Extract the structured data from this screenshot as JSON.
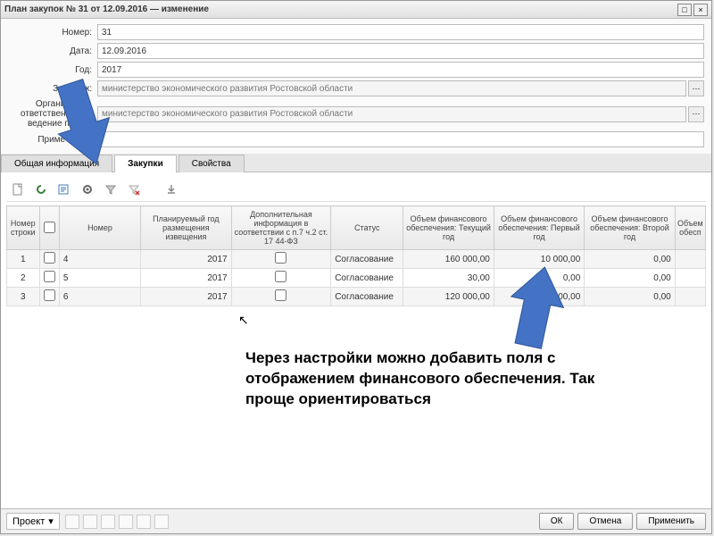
{
  "window": {
    "title": "План закупок № 31 от 12.09.2016 — изменение"
  },
  "form": {
    "number_label": "Номер:",
    "number": "31",
    "date_label": "Дата:",
    "date": "12.09.2016",
    "year_label": "Год:",
    "year": "2017",
    "customer_label": "Заказчик:",
    "customer": "министерство экономического развития Ростовской области",
    "org_label": "Организация, ответственная за ведение плана:",
    "org": "министерство экономического развития Ростовской области",
    "note_label": "Примечание:",
    "note": ""
  },
  "tabs": {
    "t0": "Общая информация",
    "t1": "Закупки",
    "t2": "Свойства"
  },
  "columns": {
    "c0": "Номер строки",
    "c1": "",
    "c2": "Номер",
    "c3": "Планируемый год размещения извещения",
    "c4": "Дополнительная информация в соответствии с п.7 ч.2 ст. 17 44-ФЗ",
    "c5": "Статус",
    "c6": "Объем финансового обеспечения: Текущий год",
    "c7": "Объем финансового обеспечения: Первый год",
    "c8": "Объем финансового обеспечения: Второй год",
    "c9": "Объем обесп"
  },
  "rows": [
    {
      "n": "1",
      "num": "4",
      "year": "2017",
      "status": "Согласование",
      "v1": "160 000,00",
      "v2": "10 000,00",
      "v3": "0,00"
    },
    {
      "n": "2",
      "num": "5",
      "year": "2017",
      "status": "Согласование",
      "v1": "30,00",
      "v2": "0,00",
      "v3": "0,00"
    },
    {
      "n": "3",
      "num": "6",
      "year": "2017",
      "status": "Согласование",
      "v1": "120 000,00",
      "v2": "2 500,00",
      "v3": "0,00"
    }
  ],
  "footer": {
    "project": "Проект",
    "ok": "ОК",
    "cancel": "Отмена",
    "apply": "Применить"
  },
  "annotation": "Через настройки можно добавить поля с отображением финансового обеспечения. Так проще ориентироваться"
}
